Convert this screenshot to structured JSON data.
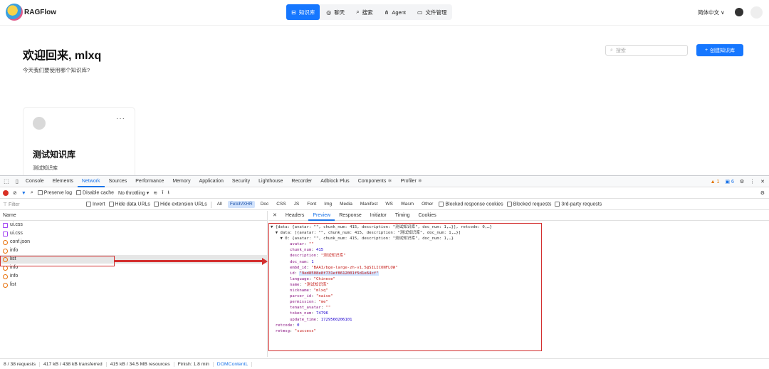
{
  "app": {
    "brand": "RAGFlow",
    "nav": [
      {
        "label": "知识库",
        "icon": "database-icon",
        "active": true
      },
      {
        "label": "聊天",
        "icon": "chat-icon",
        "active": false
      },
      {
        "label": "搜索",
        "icon": "search-icon",
        "active": false
      },
      {
        "label": "Agent",
        "icon": "agent-icon",
        "active": false
      },
      {
        "label": "文件管理",
        "icon": "folder-icon",
        "active": false
      }
    ],
    "language": "简体中文",
    "welcome": "欢迎回来, mlxq",
    "subtitle": "今天我们要使用哪个知识库?",
    "search_placeholder": "搜索",
    "create_label": "创建知识库",
    "card": {
      "title": "测试知识库",
      "description": "测试知识库"
    }
  },
  "devtools": {
    "tabs": [
      "Console",
      "Elements",
      "Network",
      "Sources",
      "Performance",
      "Memory",
      "Application",
      "Security",
      "Lighthouse",
      "Recorder",
      "Adblock Plus",
      "Components ⚛",
      "Profiler ⚛"
    ],
    "active_tab": "Network",
    "warn_count": "1",
    "info_count": "6",
    "toolbar": {
      "preserve_log": "Preserve log",
      "disable_cache": "Disable cache",
      "throttling": "No throttling"
    },
    "filter": {
      "placeholder": "Filter",
      "invert": "Invert",
      "hide_data_urls": "Hide data URLs",
      "hide_extension_urls": "Hide extension URLs",
      "types": [
        "All",
        "Fetch/XHR",
        "Doc",
        "CSS",
        "JS",
        "Font",
        "Img",
        "Media",
        "Manifest",
        "WS",
        "Wasm",
        "Other"
      ],
      "active_type": "Fetch/XHR",
      "blocked_cookies": "Blocked response cookies",
      "blocked_requests": "Blocked requests",
      "third_party": "3rd-party requests"
    },
    "name_header": "Name",
    "requests": [
      {
        "name": "ui.css",
        "type": "css"
      },
      {
        "name": "ui.css",
        "type": "css"
      },
      {
        "name": "conf.json",
        "type": "xhr"
      },
      {
        "name": "info",
        "type": "xhr"
      },
      {
        "name": "list",
        "type": "xhr",
        "selected": true
      },
      {
        "name": "info",
        "type": "xhr"
      },
      {
        "name": "info",
        "type": "xhr"
      },
      {
        "name": "list",
        "type": "xhr"
      }
    ],
    "detail_tabs": [
      "Headers",
      "Preview",
      "Response",
      "Initiator",
      "Timing",
      "Cookies"
    ],
    "active_detail_tab": "Preview",
    "preview": {
      "line1": "▼ {data: {avatar: \"\", chunk_num: 415, description: \"测试知识库\", doc_num: 1,…}], retcode: 0,…}",
      "line2": "  ▼ data: [{avatar: \"\", chunk_num: 415, description: \"测试知识库\", doc_num: 1,…}]",
      "line3": "    ▼ 0: {avatar: \"\", chunk_num: 415, description: \"测试知识库\", doc_num: 1,…}",
      "fields": [
        {
          "key": "avatar",
          "value": "\"\"",
          "kind": "s"
        },
        {
          "key": "chunk_num",
          "value": "415",
          "kind": "n"
        },
        {
          "key": "description",
          "value": "\"测试知识库\"",
          "kind": "s"
        },
        {
          "key": "doc_num",
          "value": "1",
          "kind": "n"
        },
        {
          "key": "embd_id",
          "value": "\"BAAI/bge-large-zh-v1.5@SILICONFLOW\"",
          "kind": "s"
        },
        {
          "key": "id",
          "value": "\"9ed8508e8f731ef8612001f5d1e64cf\"",
          "kind": "s",
          "highlight": true
        },
        {
          "key": "language",
          "value": "\"Chinese\"",
          "kind": "s"
        },
        {
          "key": "name",
          "value": "\"测试知识库\"",
          "kind": "s"
        },
        {
          "key": "nickname",
          "value": "\"mlxq\"",
          "kind": "s"
        },
        {
          "key": "parser_id",
          "value": "\"naive\"",
          "kind": "s"
        },
        {
          "key": "permission",
          "value": "\"me\"",
          "kind": "s"
        },
        {
          "key": "tenant_avatar",
          "value": "\"\"",
          "kind": "s"
        },
        {
          "key": "token_num",
          "value": "74796",
          "kind": "n"
        },
        {
          "key": "update_time",
          "value": "1729560206101",
          "kind": "n"
        }
      ],
      "retcode": "0",
      "retmsg": "\"success\""
    },
    "status": [
      "8 / 38 requests",
      "417 kB / 438 kB transferred",
      "415 kB / 34.5 MB resources",
      "Finish: 1.8 min",
      "DOMContentL"
    ]
  }
}
